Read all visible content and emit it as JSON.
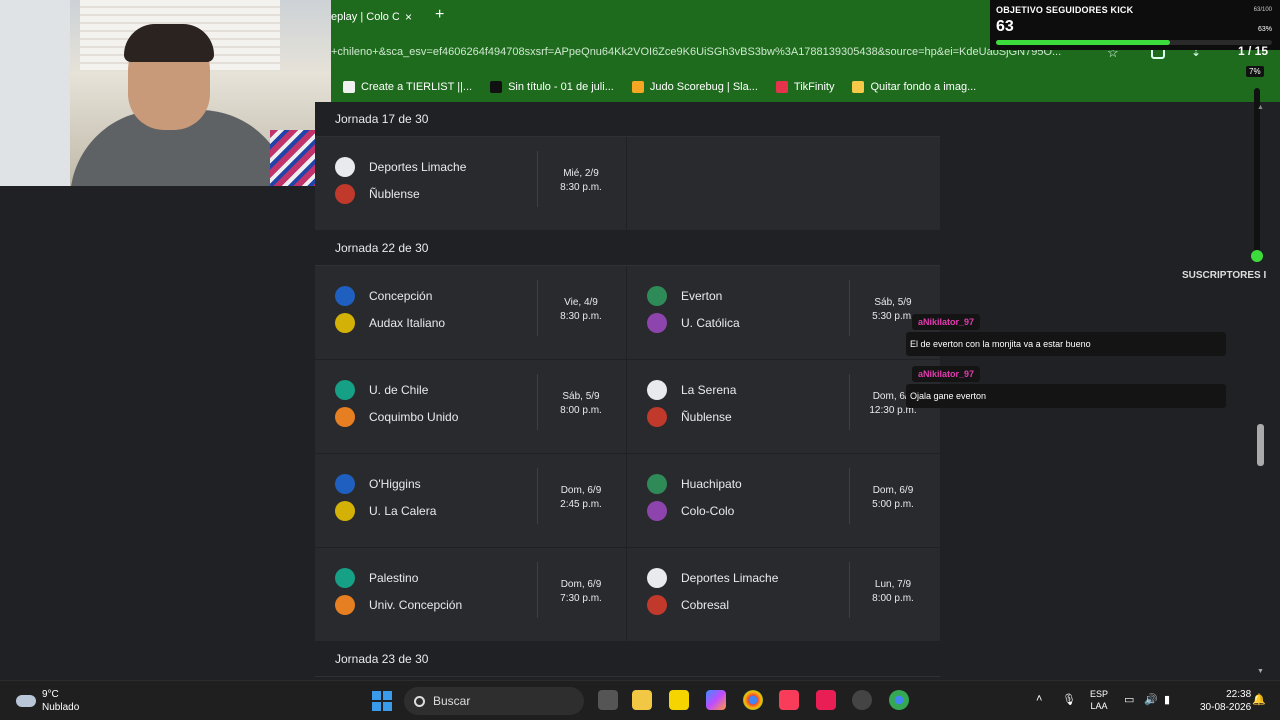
{
  "browser": {
    "tab_title": "eplay | Colo Co",
    "tab_close": "×",
    "new_tab": "+",
    "url": "+chileno+&sca_esv=ef4606264f494708sxsrf=APpeQnu64Kk2VOI6Zce9K6UiSGh3vBS3bw%3A1788139305438&source=hp&ei=KdeUaoSjGN795O...",
    "bookmarks": [
      {
        "label": "Create a TIERLIST ||...",
        "color": "#f0f0f0"
      },
      {
        "label": "Sin título - 01 de juli...",
        "color": "#111111"
      },
      {
        "label": "Judo Scorebug | Sla...",
        "color": "#f5a623"
      },
      {
        "label": "TikFinity",
        "color": "#e5334b"
      },
      {
        "label": "Quitar fondo a imag...",
        "color": "#f7c948"
      }
    ]
  },
  "jornadas": [
    {
      "title": "Jornada 17 de 30",
      "rows": [
        [
          {
            "home": "Deportes Limache",
            "away": "Ñublense",
            "day": "Mié, 2/9",
            "time": "8:30 p.m."
          },
          null
        ]
      ]
    },
    {
      "title": "Jornada 22 de 30",
      "rows": [
        [
          {
            "home": "Concepción",
            "away": "Audax Italiano",
            "day": "Vie, 4/9",
            "time": "8:30 p.m."
          },
          {
            "home": "Everton",
            "away": "U. Católica",
            "day": "Sáb, 5/9",
            "time": "5:30 p.m."
          }
        ],
        [
          {
            "home": "U. de Chile",
            "away": "Coquimbo Unido",
            "day": "Sáb, 5/9",
            "time": "8:00 p.m."
          },
          {
            "home": "La Serena",
            "away": "Ñublense",
            "day": "Dom, 6/9",
            "time": "12:30 p.m."
          }
        ],
        [
          {
            "home": "O'Higgins",
            "away": "U. La Calera",
            "day": "Dom, 6/9",
            "time": "2:45 p.m."
          },
          {
            "home": "Huachipato",
            "away": "Colo-Colo",
            "day": "Dom, 6/9",
            "time": "5:00 p.m."
          }
        ],
        [
          {
            "home": "Palestino",
            "away": "Univ. Concepción",
            "day": "Dom, 6/9",
            "time": "7:30 p.m."
          },
          {
            "home": "Deportes Limache",
            "away": "Cobresal",
            "day": "Lun, 7/9",
            "time": "8:00 p.m."
          }
        ]
      ]
    },
    {
      "title": "Jornada 23 de 30",
      "rows": []
    }
  ],
  "overlay": {
    "goal_title": "OBJETIVO SEGUIDORES KICK",
    "goal_count": "63",
    "goal_max": "63/100",
    "goal_pct": "63%",
    "goal_fraction": 0.63,
    "count2": "1 / 15",
    "pct2": "7%",
    "subs_label": "SUSCRIPTORES I",
    "chat": [
      {
        "user": "aNikilator_97",
        "msg": "El de everton con la monjita va a estar bueno"
      },
      {
        "user": "aNikilator_97",
        "msg": "Ojala gane everton"
      }
    ]
  },
  "taskbar": {
    "temp": "9°C",
    "condition": "Nublado",
    "search_label": "Buscar",
    "lang1": "ESP",
    "lang2": "LAA",
    "time": "22:38",
    "date": "30-08-2026"
  }
}
